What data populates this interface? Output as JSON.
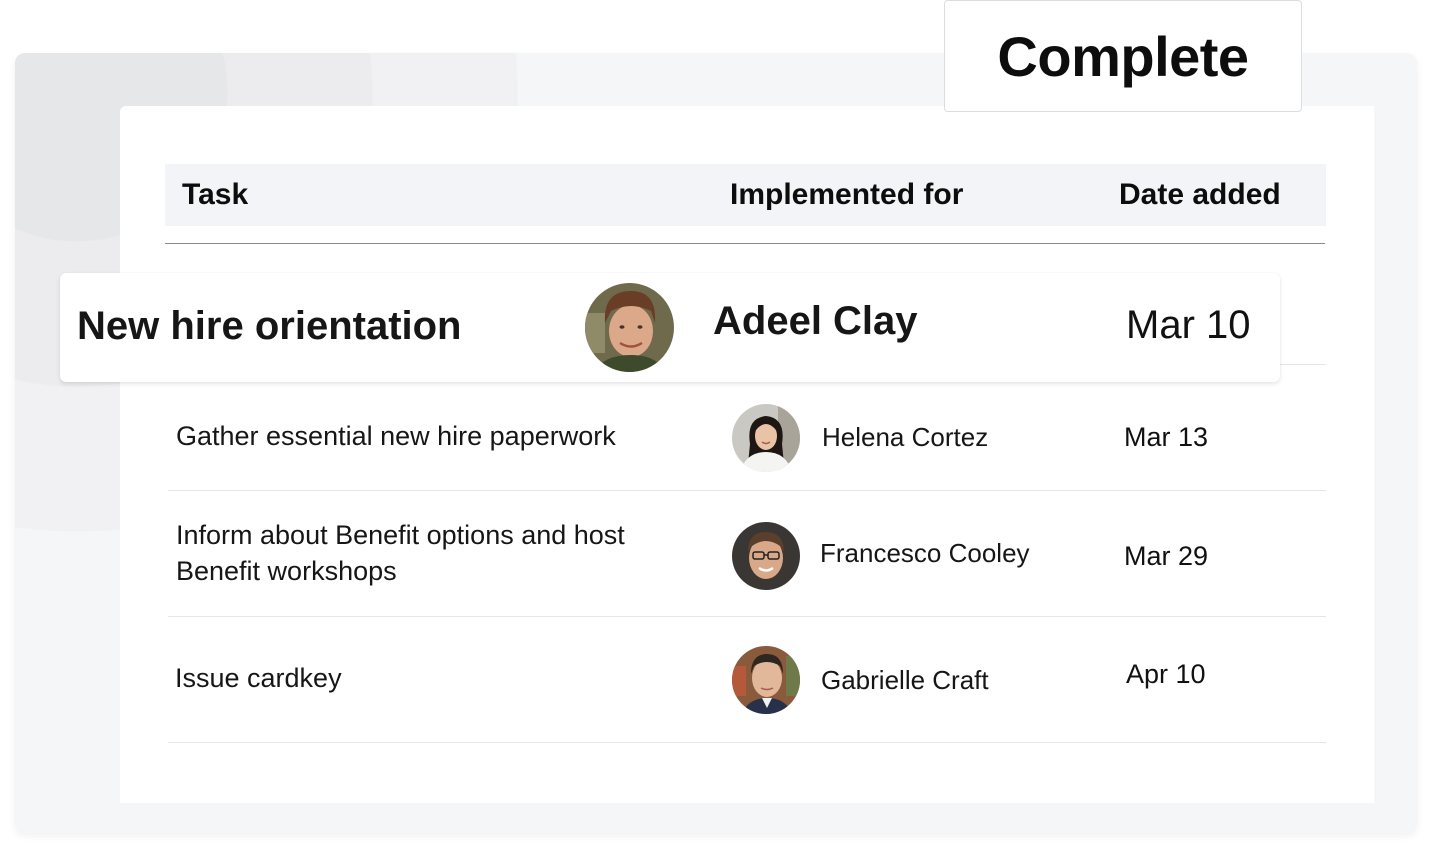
{
  "status_badge": {
    "label": "Complete"
  },
  "table": {
    "columns": {
      "task": "Task",
      "implemented_for": "Implemented for",
      "date_added": "Date added"
    },
    "highlighted_row": {
      "task": "New hire orientation",
      "person": "Adeel Clay",
      "avatar": "man-avatar",
      "date": "Mar 10"
    },
    "rows": [
      {
        "task_line1": "Gather essential new hire paperwork",
        "task_line2": "",
        "person": "Helena Cortez",
        "avatar": "woman-avatar",
        "date": "Mar 13"
      },
      {
        "task_line1": "Inform about Benefit options and host",
        "task_line2": "Benefit workshops",
        "person": "Francesco Cooley",
        "avatar": "man-glasses-avatar",
        "date": "Mar 29"
      },
      {
        "task_line1": "Issue cardkey",
        "task_line2": "",
        "person": "Gabrielle Craft",
        "avatar": "man-suit-avatar",
        "date": "Apr 10"
      }
    ]
  },
  "colors": {
    "header_bg": "#f3f4f7",
    "backdrop_bg": "#f5f6f8",
    "text": "#161616"
  }
}
